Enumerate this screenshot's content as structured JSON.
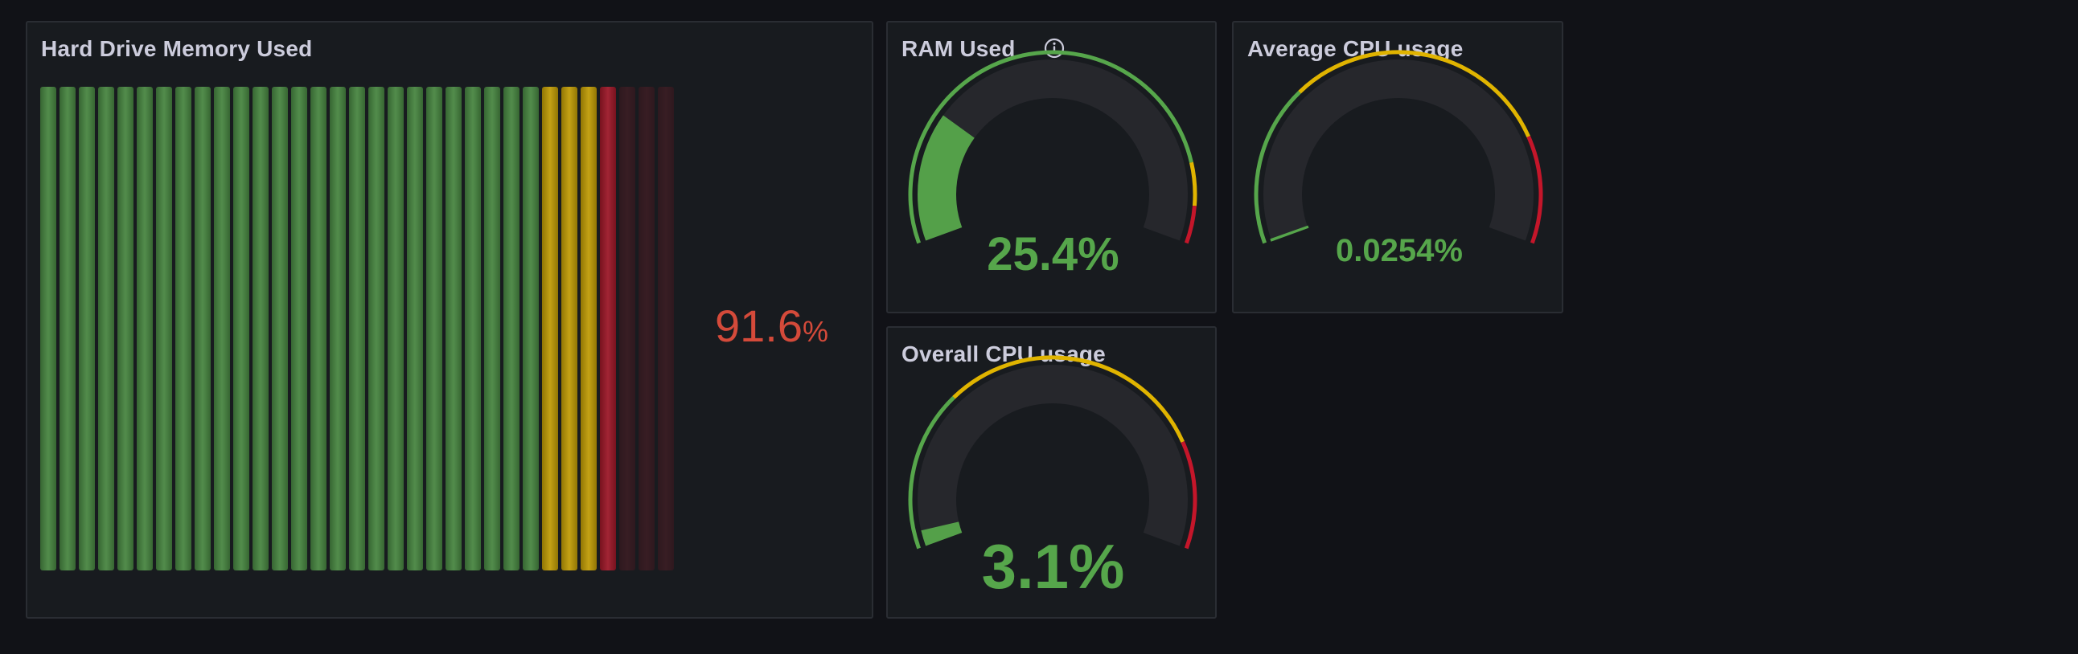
{
  "panels": {
    "hard_drive": {
      "title": "Hard Drive Memory Used",
      "value_number": "91.6",
      "value_unit": "%",
      "value_fraction": 0.916,
      "cell_count": 33,
      "thresholds": {
        "yellow_from": 0.79,
        "red_from": 0.88
      },
      "colors": {
        "green": "#56a64b",
        "yellow": "#e0b400",
        "red": "#c4162a",
        "value": "#d44a3a"
      }
    },
    "ram": {
      "title": "RAM Used",
      "info_icon": "info-circle-icon",
      "value_text": "25.4%",
      "value_fraction": 0.254,
      "thresholds": [
        {
          "from": 0,
          "to": 0.85,
          "color": "#56a64b"
        },
        {
          "from": 0.85,
          "to": 0.93,
          "color": "#e0b400"
        },
        {
          "from": 0.93,
          "to": 1,
          "color": "#c4162a"
        }
      ],
      "value_color": "#56a64b"
    },
    "avg_cpu": {
      "title": "Average CPU usage",
      "value_text": "0.0254%",
      "value_fraction": 0.000254,
      "thresholds": [
        {
          "from": 0,
          "to": 0.3,
          "color": "#56a64b"
        },
        {
          "from": 0.3,
          "to": 0.8,
          "color": "#e0b400"
        },
        {
          "from": 0.8,
          "to": 1,
          "color": "#c4162a"
        }
      ],
      "value_color": "#56a64b"
    },
    "overall_cpu": {
      "title": "Overall CPU usage",
      "value_text": "3.1%",
      "value_fraction": 0.031,
      "thresholds": [
        {
          "from": 0,
          "to": 0.3,
          "color": "#56a64b"
        },
        {
          "from": 0.3,
          "to": 0.8,
          "color": "#e0b400"
        },
        {
          "from": 0.8,
          "to": 1,
          "color": "#c4162a"
        }
      ],
      "value_color": "#56a64b"
    }
  }
}
